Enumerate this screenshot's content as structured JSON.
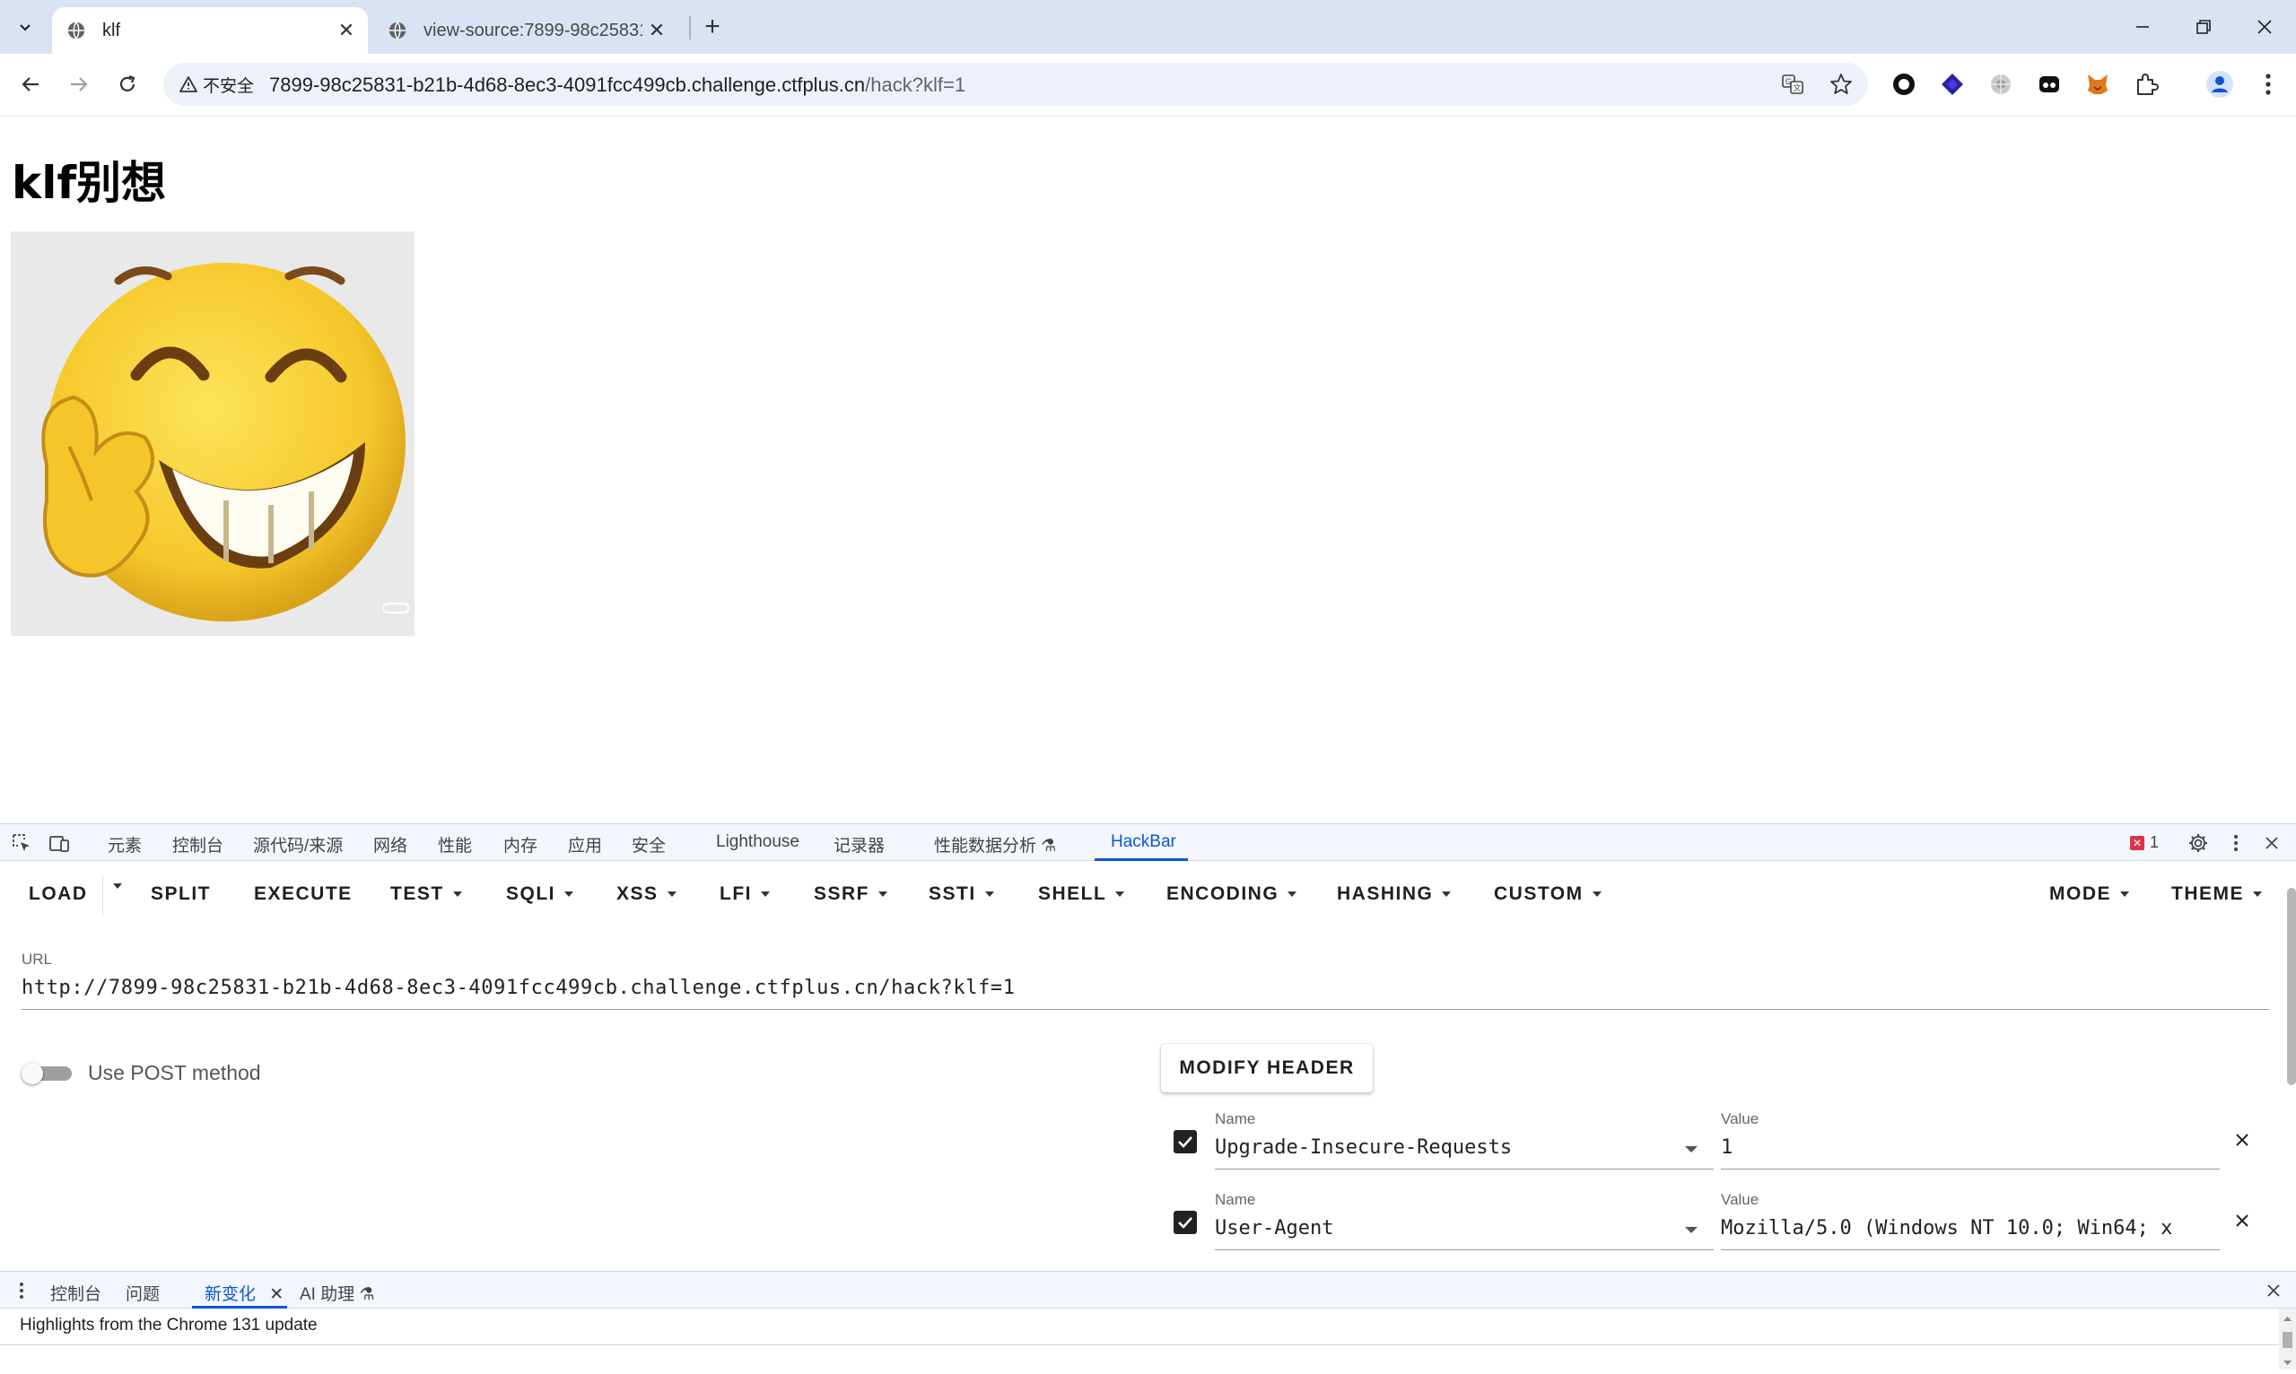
{
  "browser": {
    "tabs": [
      {
        "title": "klf",
        "active": true
      },
      {
        "title": "view-source:7899-98c25831-",
        "active": false
      }
    ],
    "security_label": "不安全",
    "url_host": "7899-98c25831-b21b-4d68-8ec3-4091fcc499cb.challenge.ctfplus.cn",
    "url_path": "/hack?klf=1",
    "extension_icons": [
      "circle-extension-icon",
      "cube-extension-icon",
      "flower-extension-icon",
      "mask-extension-icon",
      "fox-extension-icon",
      "puzzle-extensions-icon"
    ]
  },
  "page": {
    "heading": "klf别想",
    "image_alt": "laughing emoji with peace sign"
  },
  "devtools": {
    "tabs": [
      "元素",
      "控制台",
      "源代码/来源",
      "网络",
      "性能",
      "内存",
      "应用",
      "安全",
      "Lighthouse",
      "记录器",
      "性能数据分析",
      "HackBar"
    ],
    "active_tab": "HackBar",
    "error_count": "1",
    "drawer": {
      "tabs": [
        "控制台",
        "问题",
        "新变化",
        "AI 助理"
      ],
      "active_tab": "新变化",
      "content": "Highlights from the Chrome 131 update"
    }
  },
  "hackbar": {
    "menu": {
      "load": "LOAD",
      "split": "SPLIT",
      "execute": "EXECUTE",
      "test": "TEST",
      "sqli": "SQLI",
      "xss": "XSS",
      "lfi": "LFI",
      "ssrf": "SSRF",
      "ssti": "SSTI",
      "shell": "SHELL",
      "encoding": "ENCODING",
      "hashing": "HASHING",
      "custom": "CUSTOM",
      "mode": "MODE",
      "theme": "THEME"
    },
    "url_label": "URL",
    "url_value": "http://7899-98c25831-b21b-4d68-8ec3-4091fcc499cb.challenge.ctfplus.cn/hack?klf=1",
    "post_label": "Use POST method",
    "post_enabled": false,
    "modify_header_label": "MODIFY HEADER",
    "headers": [
      {
        "name_label": "Name",
        "name": "Upgrade-Insecure-Requests",
        "value_label": "Value",
        "value": "1",
        "enabled": true
      },
      {
        "name_label": "Name",
        "name": "User-Agent",
        "value_label": "Value",
        "value": "Mozilla/5.0 (Windows NT 10.0; Win64; x",
        "enabled": true
      }
    ]
  }
}
